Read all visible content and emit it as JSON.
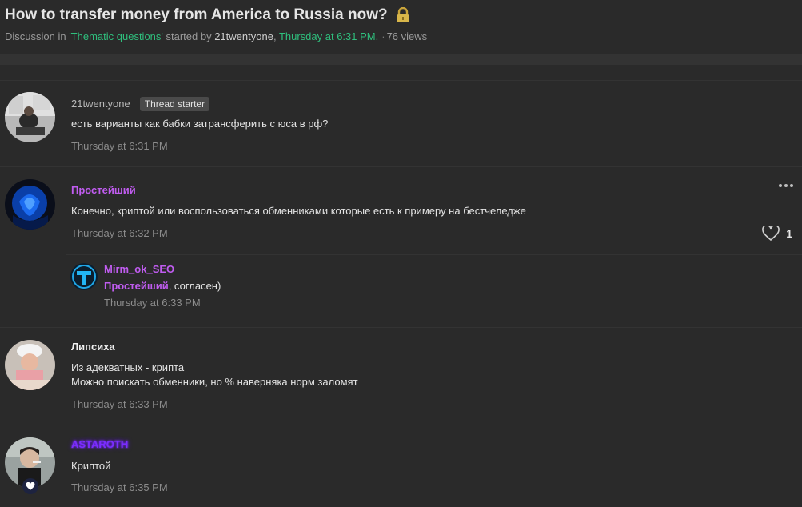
{
  "thread": {
    "title": "How to transfer money from America to Russia now?",
    "meta_prefix": "Discussion in ",
    "forum": "'Thematic questions'",
    "meta_started": " started by ",
    "starter": "21twentyone",
    "comma": ", ",
    "started_time": "Thursday at 6:31 PM.",
    "views": "76 views"
  },
  "posts": [
    {
      "username": "21twentyone",
      "badge": "Thread starter",
      "message": "есть варианты как бабки затрансферить с юса в рф?",
      "time": "Thursday at 6:31 PM"
    },
    {
      "username": "Простейший",
      "message": "Конечно, криптой или воспользоваться обменниками которые есть к примеру на бестчеледже",
      "time": "Thursday at 6:32 PM",
      "likes": "1",
      "reply": {
        "username": "Mirm_ok_SEO",
        "mention": "Простейший",
        "message_rest": ", согласен)",
        "time": "Thursday at 6:33 PM"
      }
    },
    {
      "username": "Липсиха",
      "message_line1": "Из адекватных - крипта",
      "message_line2": "Можно поискать обменники, но % наверняка норм заломят",
      "time": "Thursday at 6:33 PM"
    },
    {
      "username": "ASTAROTH",
      "message": "Криптой",
      "time": "Thursday at 6:35 PM"
    }
  ],
  "colors": {
    "background": "#2a2a2a",
    "link_green": "#2fbf7d",
    "purple_user": "#c05cf0",
    "astaroth_glow": "#7b2cff"
  },
  "icons": [
    "lock-icon",
    "more-options-icon",
    "heart-icon",
    "heart-badge-icon"
  ]
}
